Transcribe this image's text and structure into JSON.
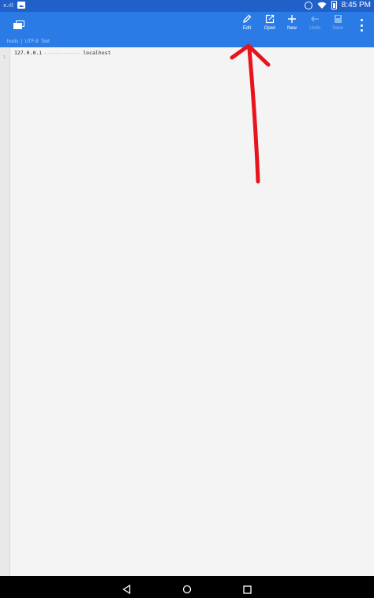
{
  "status_bar": {
    "signal_text": "x.ıll",
    "time": "8:45 PM",
    "icons": [
      "signal-icon",
      "image-notification-icon",
      "alarm-icon",
      "wifi-icon",
      "battery-icon"
    ]
  },
  "toolbar": {
    "background_color": "#2a7be5",
    "buttons": [
      {
        "label": "Edit",
        "icon": "pencil-icon",
        "enabled": true
      },
      {
        "label": "Open",
        "icon": "open-file-icon",
        "enabled": true
      },
      {
        "label": "New",
        "icon": "plus-icon",
        "enabled": true
      },
      {
        "label": "Undo",
        "icon": "undo-arrow-icon",
        "enabled": false
      },
      {
        "label": "Save",
        "icon": "save-disk-icon",
        "enabled": false
      }
    ],
    "path": {
      "file": "hosts",
      "separator": "|",
      "encoding": "UTF-8",
      "type": "Text"
    }
  },
  "editor": {
    "line_numbers": [
      "1"
    ],
    "lines": [
      {
        "ip": "127.0.0.1",
        "host": "localhost"
      }
    ]
  },
  "annotation": {
    "color": "#e8141b",
    "points_to": "Edit"
  },
  "navigation_bar": {
    "buttons": [
      "back-icon",
      "home-icon",
      "recents-icon"
    ]
  }
}
